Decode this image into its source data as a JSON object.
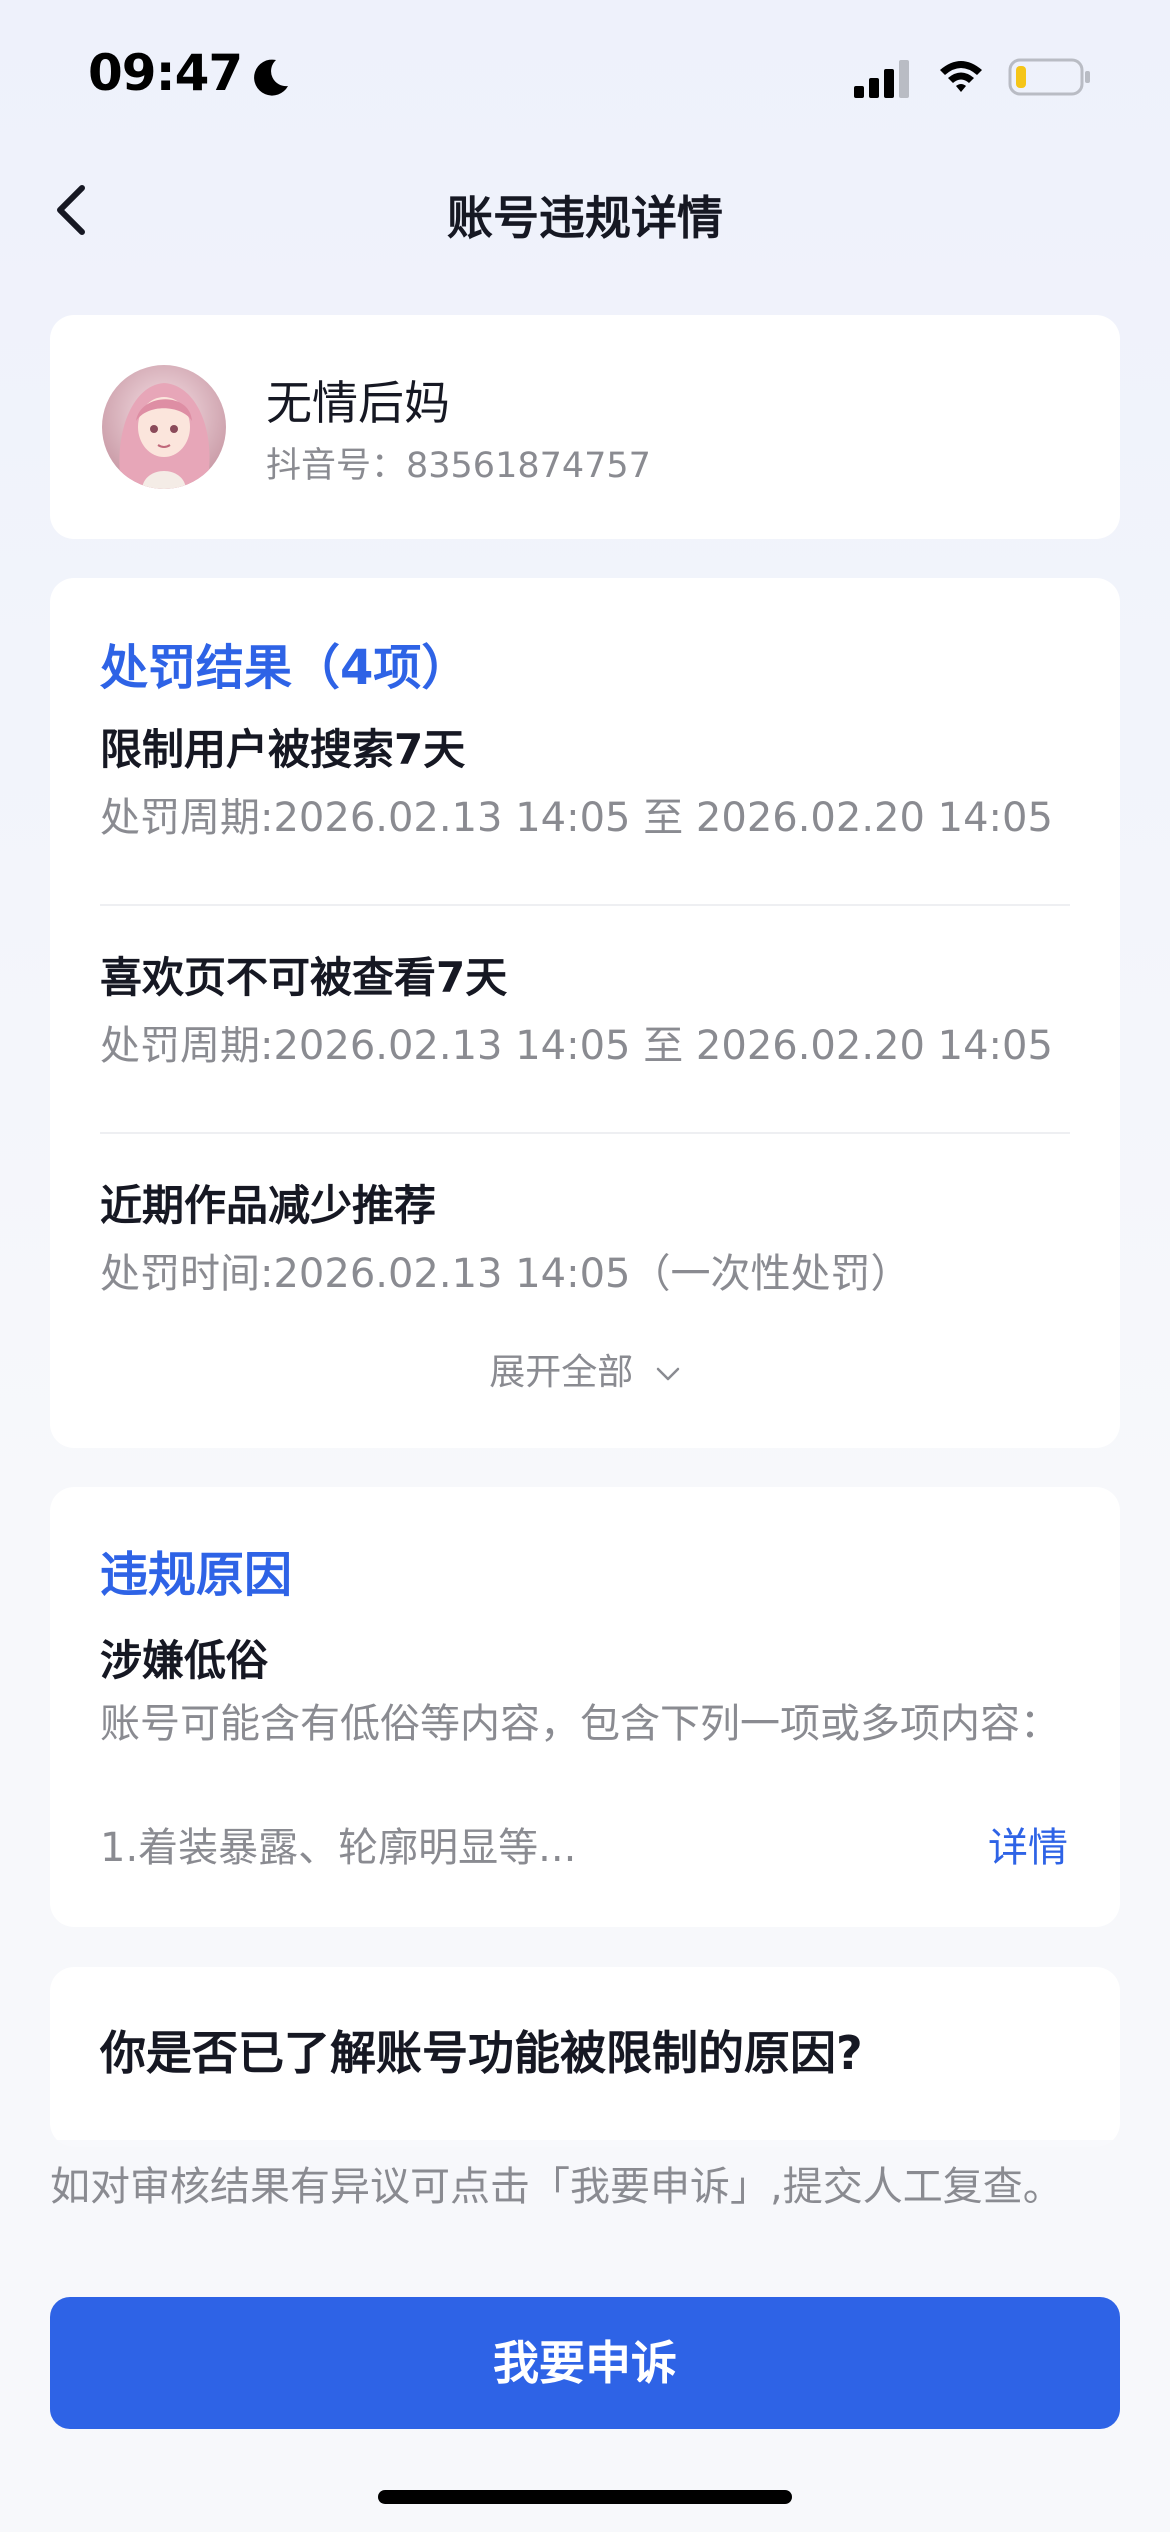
{
  "status_bar": {
    "time": "09:47",
    "icons": [
      "moon-icon",
      "signal-icon",
      "wifi-icon",
      "battery-icon"
    ],
    "battery_level": 0.15
  },
  "nav": {
    "title": "账号违规详情",
    "back_icon": "back-chevron-icon"
  },
  "profile": {
    "nickname": "无情后妈",
    "douyin_id": "抖音号：83561874757"
  },
  "punishments": {
    "title": "处罚结果（4项）",
    "items": [
      {
        "name": "限制用户被搜索7天",
        "period": "处罚周期:2026.02.13 14:05 至 2026.02.20 14:05"
      },
      {
        "name": "喜欢页不可被查看7天",
        "period": "处罚周期:2026.02.13 14:05 至 2026.02.20 14:05"
      },
      {
        "name": "近期作品减少推荐",
        "period": "处罚时间:2026.02.13 14:05（一次性处罚）"
      }
    ],
    "expand_label": "展开全部"
  },
  "reason": {
    "title": "违规原因",
    "name": "涉嫌低俗",
    "description": "账号可能含有低俗等内容，包含下列一项或多项内容：",
    "item": "1.着装暴露、轮廓明显等...",
    "detail_link": "详情"
  },
  "question": {
    "text": "你是否已了解账号功能被限制的原因?"
  },
  "appeal": {
    "hint": "如对审核结果有异议可点击「我要申诉」,提交人工复查。",
    "button_label": "我要申诉"
  },
  "colors": {
    "accent": "#2e63e6",
    "text_primary": "#161823",
    "text_secondary": "#8a8b91",
    "background": "#f3f5fb"
  }
}
